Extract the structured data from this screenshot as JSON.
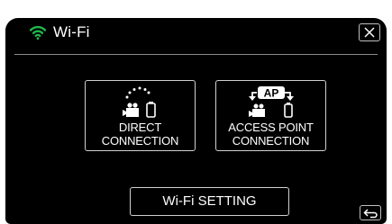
{
  "header": {
    "title": "Wi-Fi",
    "status_icon": "wifi-icon",
    "close_icon": "close-icon"
  },
  "options": [
    {
      "icon": "direct-connection-icon",
      "line1": "DIRECT",
      "line2": "CONNECTION"
    },
    {
      "icon": "access-point-icon",
      "badge": "AP",
      "line1": "ACCESS POINT",
      "line2": "CONNECTION"
    }
  ],
  "footer": {
    "setting_label": "Wi-Fi SETTING",
    "back_icon": "return-icon"
  },
  "colors": {
    "background": "#000000",
    "text": "#ffffff",
    "wifi_icon": "#1fb84a",
    "border": "#d0d0d0"
  }
}
